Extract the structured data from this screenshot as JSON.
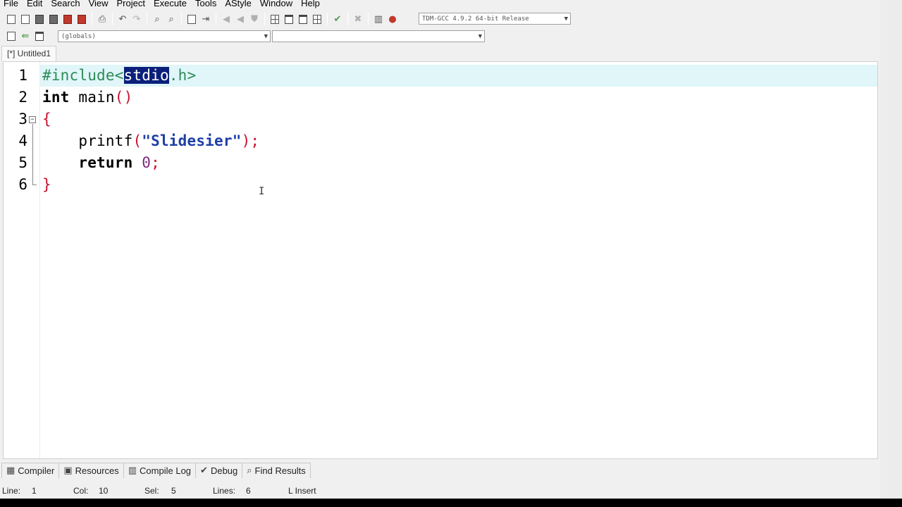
{
  "menu": [
    "File",
    "Edit",
    "Search",
    "View",
    "Project",
    "Execute",
    "Tools",
    "AStyle",
    "Window",
    "Help"
  ],
  "toolbar": {
    "compiler_selected": "TDM-GCC 4.9.2 64-bit Release",
    "scope_selected": "(globals)",
    "member_selected": ""
  },
  "tab": {
    "label": "[*] Untitled1"
  },
  "editor": {
    "line_numbers": [
      "1",
      "2",
      "3",
      "4",
      "5",
      "6"
    ],
    "line1": {
      "pre": "#include<",
      "selected": "stdio",
      "post": ".h>"
    },
    "line2": {
      "kw": "int",
      "name": " main",
      "paren": "()"
    },
    "line3": {
      "brace": "{"
    },
    "line4": {
      "indent": "    ",
      "fn": "printf",
      "open": "(",
      "str": "\"Slidesier\"",
      "close": ");"
    },
    "line5": {
      "indent": "    ",
      "kw": "return",
      "sp": " ",
      "num": "0",
      "semi": ";"
    },
    "line6": {
      "brace": "}"
    },
    "mouse_cursor": "I"
  },
  "bottom_tabs": [
    {
      "icon": "compiler-icon",
      "label": "Compiler"
    },
    {
      "icon": "resources-icon",
      "label": "Resources"
    },
    {
      "icon": "compile-log-icon",
      "label": "Compile Log"
    },
    {
      "icon": "debug-icon",
      "label": "Debug"
    },
    {
      "icon": "find-results-icon",
      "label": "Find Results"
    }
  ],
  "status": {
    "line_label": "Line:",
    "line_value": "1",
    "col_label": "Col:",
    "col_value": "10",
    "sel_label": "Sel:",
    "sel_value": "5",
    "lines_label": "Lines:",
    "lines_value": "6",
    "mode": "L Insert"
  },
  "colors": {
    "active_line": "#e0f6f9",
    "selection": "#0b1f7a",
    "preprocessor": "#2e8b57",
    "string": "#1e3fa6",
    "punct": "#c8102e"
  }
}
